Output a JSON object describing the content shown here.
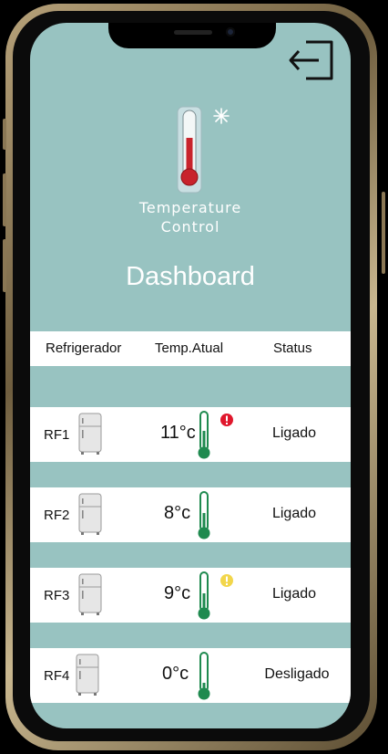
{
  "app": {
    "brand_line1": "Temperature",
    "brand_line2": "Control",
    "page_title": "Dashboard"
  },
  "table": {
    "headers": [
      "Refrigerador",
      "Temp.Atual",
      "Status"
    ],
    "rows": [
      {
        "id": "RF1",
        "temp": "11°c",
        "status": "Ligado",
        "alert": "red"
      },
      {
        "id": "RF2",
        "temp": "8°c",
        "status": "Ligado",
        "alert": "none"
      },
      {
        "id": "RF3",
        "temp": "9°c",
        "status": "Ligado",
        "alert": "yellow"
      },
      {
        "id": "RF4",
        "temp": "0°c",
        "status": "Desligado",
        "alert": "none"
      }
    ]
  },
  "colors": {
    "screen_bg": "#98c3c1",
    "thermo_green": "#1f8a4f",
    "alert_red": "#e0172c",
    "alert_yellow": "#f2d64b"
  },
  "icons": {
    "logout": "logout-icon",
    "fridge": "fridge-icon",
    "thermometer": "thermometer-icon",
    "snowflake": "snowflake-icon"
  }
}
